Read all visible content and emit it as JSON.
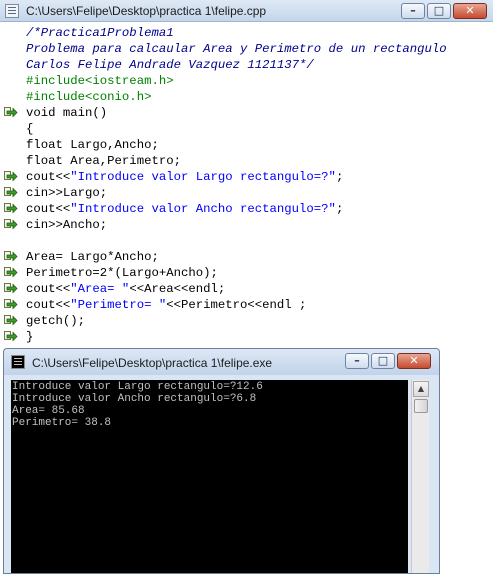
{
  "editor": {
    "title": "C:\\Users\\Felipe\\Desktop\\practica 1\\felipe.cpp",
    "lines": [
      [
        {
          "t": "/*Practica1Problema1",
          "c": "c-comment"
        }
      ],
      [
        {
          "t": "Problema para calcaular Area y Perimetro de un rectangulo",
          "c": "c-comment"
        }
      ],
      [
        {
          "t": "Carlos Felipe Andrade Vazquez 1121137*/",
          "c": "c-comment"
        }
      ],
      [
        {
          "t": "#include<iostream.h>",
          "c": "c-pre"
        }
      ],
      [
        {
          "t": "#include<conio.h>",
          "c": "c-pre"
        }
      ],
      [
        {
          "t": "void main()",
          "c": ""
        }
      ],
      [
        {
          "t": "{",
          "c": ""
        }
      ],
      [
        {
          "t": "float Largo,Ancho;",
          "c": ""
        }
      ],
      [
        {
          "t": "float Area,Perimetro;",
          "c": ""
        }
      ],
      [
        {
          "t": "cout<<",
          "c": ""
        },
        {
          "t": "\"Introduce valor Largo rectangulo=?\"",
          "c": "c-str"
        },
        {
          "t": ";",
          "c": ""
        }
      ],
      [
        {
          "t": "cin>>Largo;",
          "c": ""
        }
      ],
      [
        {
          "t": "cout<<",
          "c": ""
        },
        {
          "t": "\"Introduce valor Ancho rectangulo=?\"",
          "c": "c-str"
        },
        {
          "t": ";",
          "c": ""
        }
      ],
      [
        {
          "t": "cin>>Ancho;",
          "c": ""
        }
      ],
      [
        {
          "t": "",
          "c": ""
        }
      ],
      [
        {
          "t": "Area= Largo*Ancho;",
          "c": ""
        }
      ],
      [
        {
          "t": "Perimetro=2*(Largo+Ancho);",
          "c": ""
        }
      ],
      [
        {
          "t": "cout<<",
          "c": ""
        },
        {
          "t": "\"Area= \"",
          "c": "c-str"
        },
        {
          "t": "<<Area<<endl;",
          "c": ""
        }
      ],
      [
        {
          "t": "cout<<",
          "c": ""
        },
        {
          "t": "\"Perimetro= \"",
          "c": "c-str"
        },
        {
          "t": "<<Perimetro<<endl ;",
          "c": ""
        }
      ],
      [
        {
          "t": "getch();",
          "c": ""
        }
      ],
      [
        {
          "t": "}",
          "c": ""
        }
      ]
    ],
    "breakpoint_lines": [
      5,
      9,
      10,
      11,
      12,
      14,
      15,
      16,
      17,
      18,
      19
    ]
  },
  "console": {
    "title": "C:\\Users\\Felipe\\Desktop\\practica 1\\felipe.exe",
    "output": [
      "Introduce valor Largo rectangulo=?12.6",
      "Introduce valor Ancho rectangulo=?6.8",
      "Area= 85.68",
      "Perimetro= 38.8"
    ]
  },
  "window_controls": {
    "minimize_glyph": "–",
    "maximize_glyph": "□",
    "close_glyph": "✕"
  },
  "colors": {
    "comment": "#00008b",
    "preprocessor": "#008000",
    "string": "#0000ff",
    "console_bg": "#000000",
    "console_text": "#c0c0c0"
  }
}
